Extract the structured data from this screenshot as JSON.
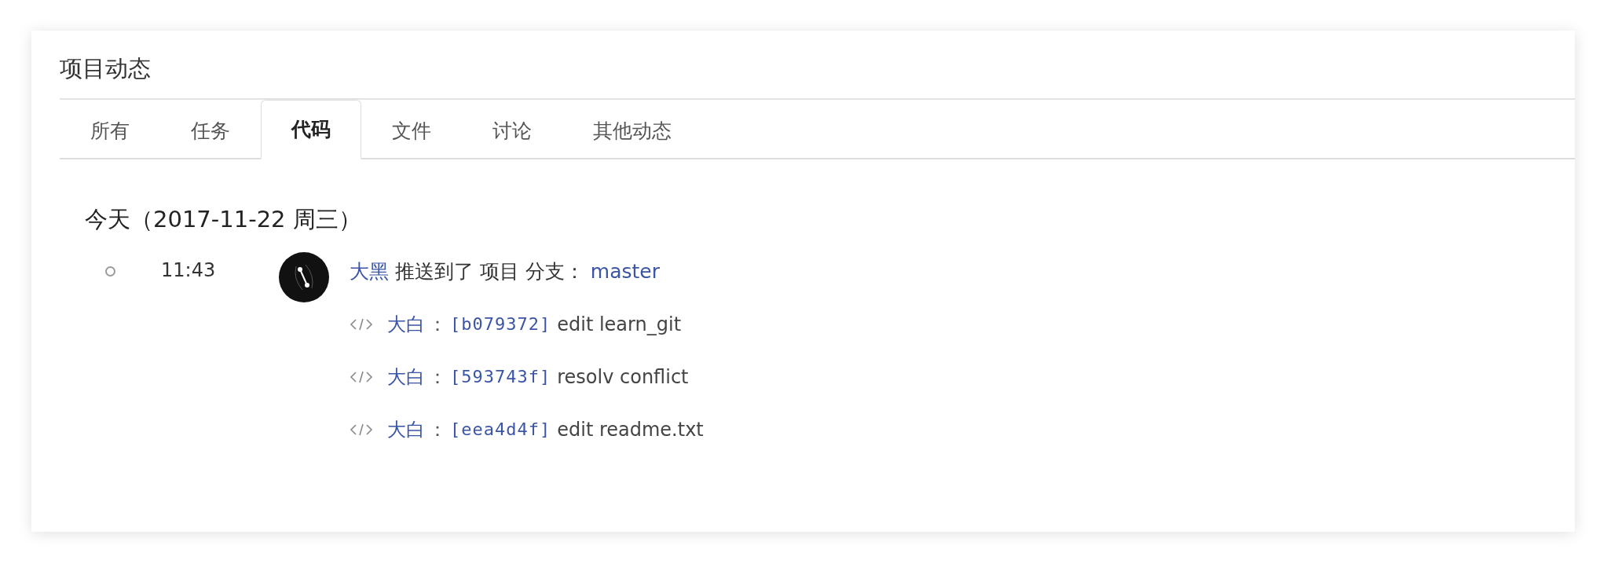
{
  "title": "项目动态",
  "tabs": [
    {
      "label": "所有",
      "selected": false
    },
    {
      "label": "任务",
      "selected": false
    },
    {
      "label": "代码",
      "selected": true
    },
    {
      "label": "文件",
      "selected": false
    },
    {
      "label": "讨论",
      "selected": false
    },
    {
      "label": "其他动态",
      "selected": false
    }
  ],
  "days": [
    {
      "date": "今天（2017-11-22 周三）",
      "events": [
        {
          "time": "11:43",
          "actor": "大黑",
          "action": "推送到了 项目 分支：",
          "branch": "master",
          "commits": [
            {
              "author": "大白",
              "separator": "：",
              "hash": "[b079372]",
              "message": "edit learn_git"
            },
            {
              "author": "大白",
              "separator": "：",
              "hash": "[593743f]",
              "message": "resolv conflict"
            },
            {
              "author": "大白",
              "separator": "：",
              "hash": "[eea4d4f]",
              "message": "edit readme.txt"
            }
          ]
        }
      ]
    }
  ]
}
